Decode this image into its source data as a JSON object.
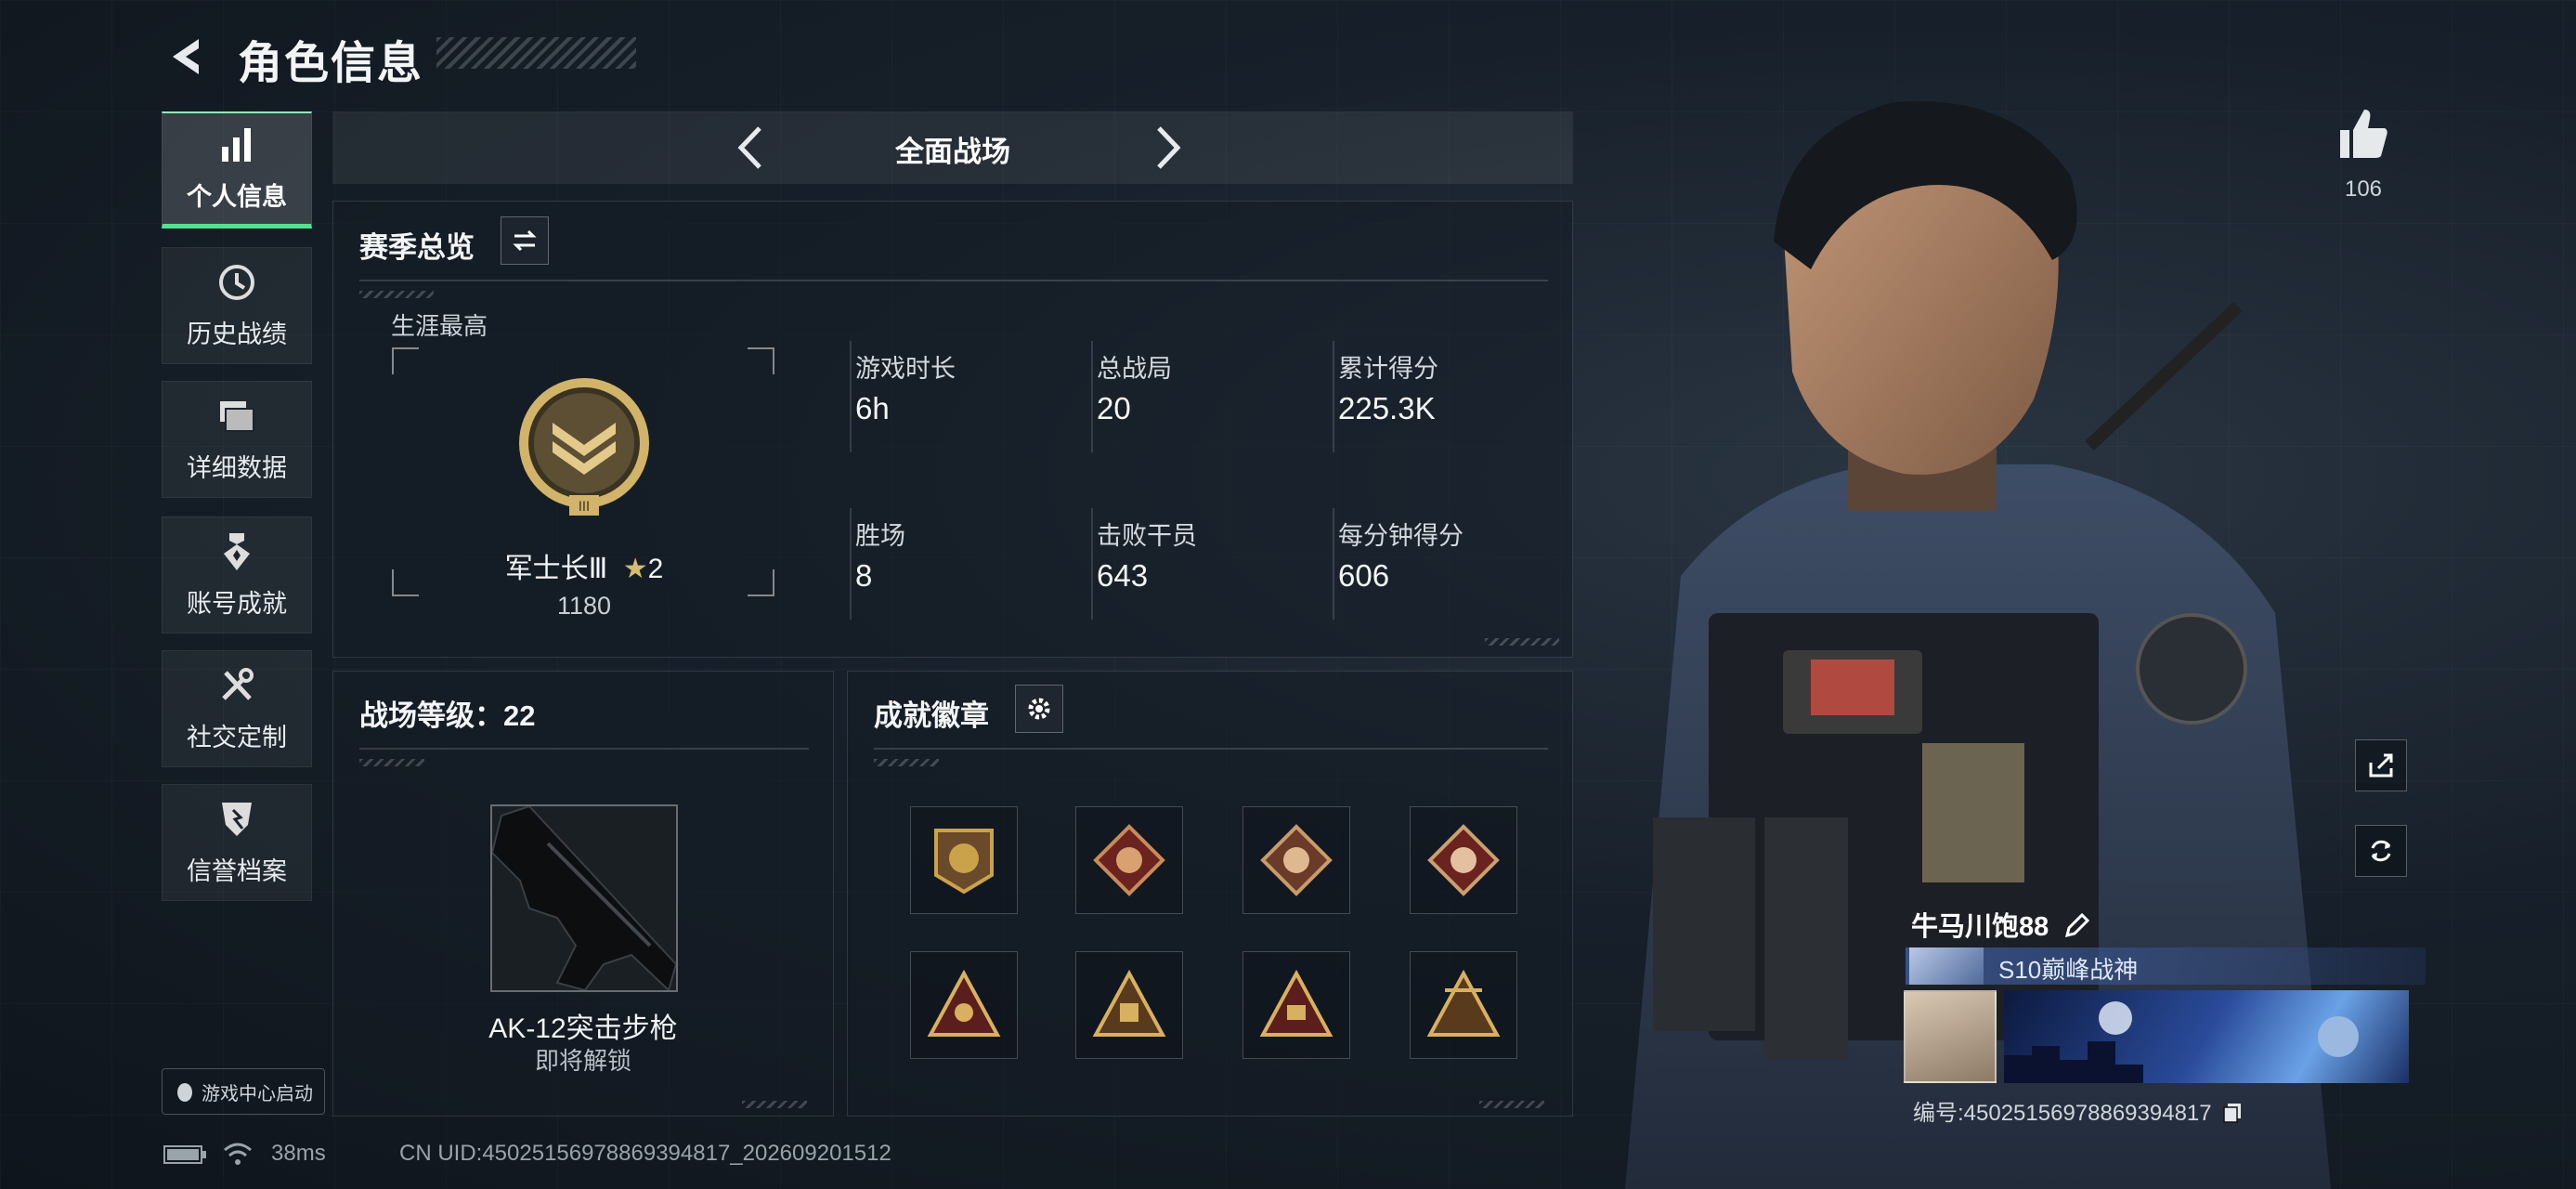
{
  "header": {
    "title": "角色信息"
  },
  "sidebar": {
    "items": [
      {
        "label": "个人信息"
      },
      {
        "label": "历史战绩"
      },
      {
        "label": "详细数据"
      },
      {
        "label": "账号成就"
      },
      {
        "label": "社交定制"
      },
      {
        "label": "信誉档案"
      }
    ],
    "game_center_label": "游戏中心启动"
  },
  "mode": {
    "label": "全面战场"
  },
  "season": {
    "title": "赛季总览",
    "career_best_label": "生涯最高",
    "rank_name": "军士长Ⅲ",
    "rank_stars": "2",
    "rank_score": "1180",
    "stats": [
      {
        "label": "游戏时长",
        "value": "6h"
      },
      {
        "label": "总战局",
        "value": "20"
      },
      {
        "label": "累计得分",
        "value": "225.3K"
      },
      {
        "label": "胜场",
        "value": "8"
      },
      {
        "label": "击败干员",
        "value": "643"
      },
      {
        "label": "每分钟得分",
        "value": "606"
      }
    ]
  },
  "battle_level": {
    "title": "战场等级：22",
    "weapon_name": "AK-12突击步枪",
    "weapon_status": "即将解锁"
  },
  "achievements": {
    "title": "成就徽章"
  },
  "player": {
    "likes": "106",
    "name": "牛马川饱88",
    "title": "S10巅峰战神",
    "uid_label": "编号:4502515697886939481​7"
  },
  "status": {
    "ping": "38ms",
    "uid": "CN UID:4502515697886939481​7_202609201512"
  },
  "colors": {
    "accent_green": "#55e08f",
    "gold": "#c9a24a"
  }
}
